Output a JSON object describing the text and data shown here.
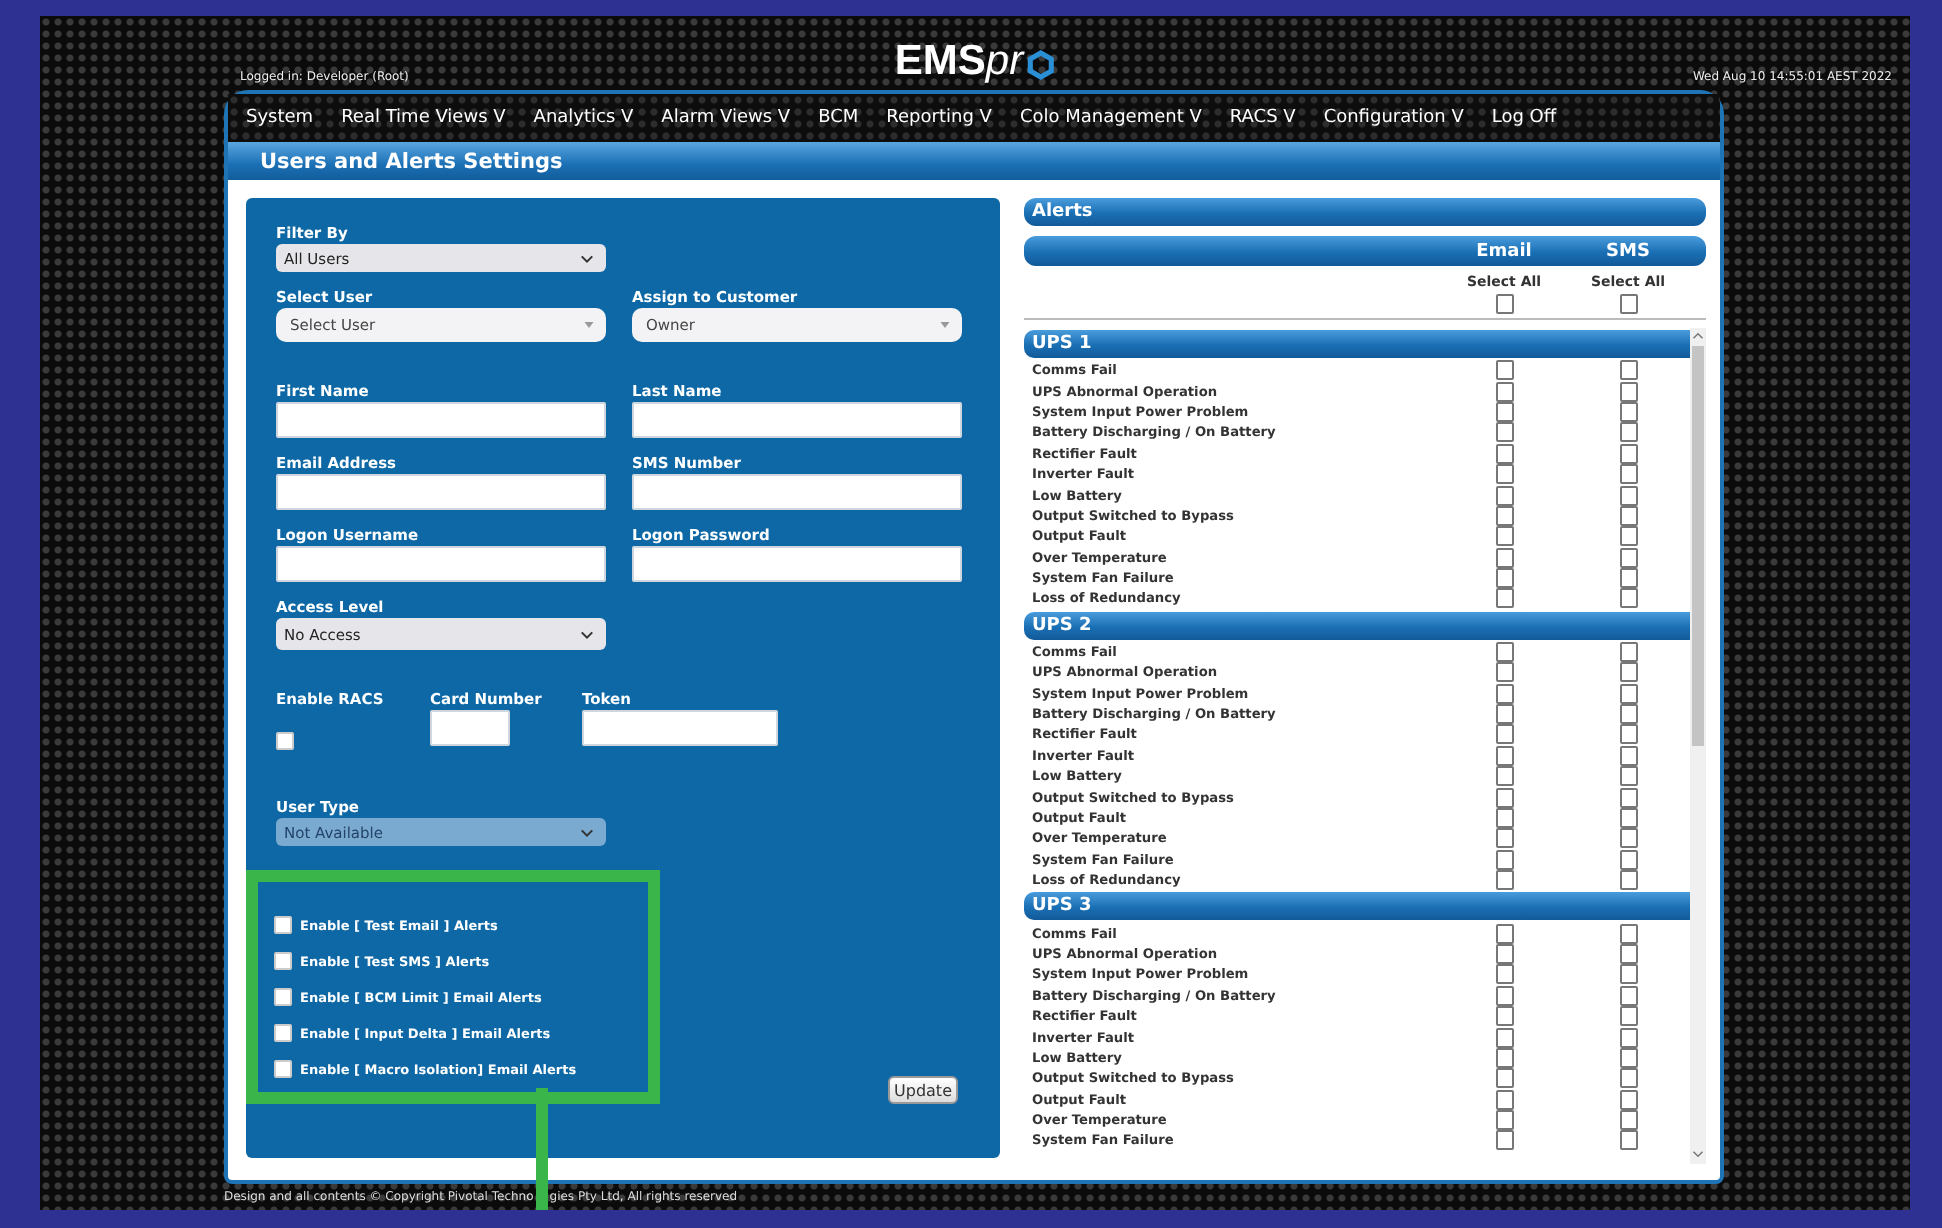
{
  "session": {
    "logged_in": "Logged in: Developer (Root)",
    "logo": "EMS",
    "logo_suffix": "pr",
    "datetime": "Wed Aug 10 14:55:01 AEST 2022"
  },
  "nav": [
    {
      "label": "System"
    },
    {
      "label": "Real Time Views V"
    },
    {
      "label": "Analytics V"
    },
    {
      "label": "Alarm Views V"
    },
    {
      "label": "BCM"
    },
    {
      "label": "Reporting V"
    },
    {
      "label": "Colo Management V"
    },
    {
      "label": "RACS V"
    },
    {
      "label": "Configuration V"
    },
    {
      "label": "Log Off"
    }
  ],
  "page_title": "Users and Alerts Settings",
  "form": {
    "filter": {
      "label": "Filter By",
      "value": "All Users"
    },
    "select_user": {
      "label": "Select User",
      "value": "Select User"
    },
    "assign": {
      "label": "Assign to Customer",
      "value": "Owner"
    },
    "inputs": [
      {
        "label": "First Name"
      },
      {
        "label": "Last Name"
      },
      {
        "label": "Email Address"
      },
      {
        "label": "SMS Number"
      },
      {
        "label": "Logon Username"
      },
      {
        "label": "Logon Password"
      }
    ],
    "access": {
      "label": "Access Level",
      "value": "No Access"
    },
    "racs": {
      "label": "Enable RACS",
      "checked": false
    },
    "card": {
      "label": "Card Number"
    },
    "token": {
      "label": "Token"
    },
    "user_type": {
      "label": "User Type",
      "value": "Not Available",
      "disabled": true
    },
    "alert_toggles": [
      {
        "label": "Enable [ Test Email ] Alerts",
        "checked": false
      },
      {
        "label": "Enable [ Test SMS ] Alerts",
        "checked": false
      },
      {
        "label": "Enable [ BCM Limit ] Email Alerts",
        "checked": false
      },
      {
        "label": "Enable [ Input Delta ] Email Alerts",
        "checked": false
      },
      {
        "label": "Enable [ Macro Isolation] Email Alerts",
        "checked": false
      }
    ],
    "update_button": "Update"
  },
  "alerts": {
    "title": "Alerts",
    "columns": [
      "Email",
      "SMS"
    ],
    "select_all": [
      {
        "label": "Select All",
        "checked": false
      },
      {
        "label": "Select All",
        "checked": false
      }
    ],
    "groups": [
      {
        "name": "UPS 1",
        "items": [
          {
            "label": "Comms Fail",
            "email": false,
            "sms": false
          },
          {
            "label": "UPS Abnormal Operation",
            "email": false,
            "sms": false
          },
          {
            "label": "System Input Power Problem",
            "email": false,
            "sms": false
          },
          {
            "label": "Battery Discharging / On Battery",
            "email": false,
            "sms": false
          },
          {
            "label": "Rectifier Fault",
            "email": false,
            "sms": false
          },
          {
            "label": "Inverter Fault",
            "email": false,
            "sms": false
          },
          {
            "label": "Low Battery",
            "email": false,
            "sms": false
          },
          {
            "label": "Output Switched to Bypass",
            "email": false,
            "sms": false
          },
          {
            "label": "Output Fault",
            "email": false,
            "sms": false
          },
          {
            "label": "Over Temperature",
            "email": false,
            "sms": false
          },
          {
            "label": "System Fan Failure",
            "email": false,
            "sms": false
          },
          {
            "label": "Loss of Redundancy",
            "email": false,
            "sms": false
          }
        ]
      },
      {
        "name": "UPS 2",
        "items": [
          {
            "label": "Comms Fail",
            "email": false,
            "sms": false
          },
          {
            "label": "UPS Abnormal Operation",
            "email": false,
            "sms": false
          },
          {
            "label": "System Input Power Problem",
            "email": false,
            "sms": false
          },
          {
            "label": "Battery Discharging / On Battery",
            "email": false,
            "sms": false
          },
          {
            "label": "Rectifier Fault",
            "email": false,
            "sms": false
          },
          {
            "label": "Inverter Fault",
            "email": false,
            "sms": false
          },
          {
            "label": "Low Battery",
            "email": false,
            "sms": false
          },
          {
            "label": "Output Switched to Bypass",
            "email": false,
            "sms": false
          },
          {
            "label": "Output Fault",
            "email": false,
            "sms": false
          },
          {
            "label": "Over Temperature",
            "email": false,
            "sms": false
          },
          {
            "label": "System Fan Failure",
            "email": false,
            "sms": false
          },
          {
            "label": "Loss of Redundancy",
            "email": false,
            "sms": false
          }
        ]
      },
      {
        "name": "UPS 3",
        "items": [
          {
            "label": "Comms Fail",
            "email": false,
            "sms": false
          },
          {
            "label": "UPS Abnormal Operation",
            "email": false,
            "sms": false
          },
          {
            "label": "System Input Power Problem",
            "email": false,
            "sms": false
          },
          {
            "label": "Battery Discharging / On Battery",
            "email": false,
            "sms": false
          },
          {
            "label": "Rectifier Fault",
            "email": false,
            "sms": false
          },
          {
            "label": "Inverter Fault",
            "email": false,
            "sms": false
          },
          {
            "label": "Low Battery",
            "email": false,
            "sms": false
          },
          {
            "label": "Output Switched to Bypass",
            "email": false,
            "sms": false
          },
          {
            "label": "Output Fault",
            "email": false,
            "sms": false
          },
          {
            "label": "Over Temperature",
            "email": false,
            "sms": false
          },
          {
            "label": "System Fan Failure",
            "email": false,
            "sms": false
          }
        ]
      }
    ]
  },
  "footer": [
    "Design and all contents © Copyright Pivotal Techno",
    "gies Pty Ltd, All rights reserved"
  ]
}
